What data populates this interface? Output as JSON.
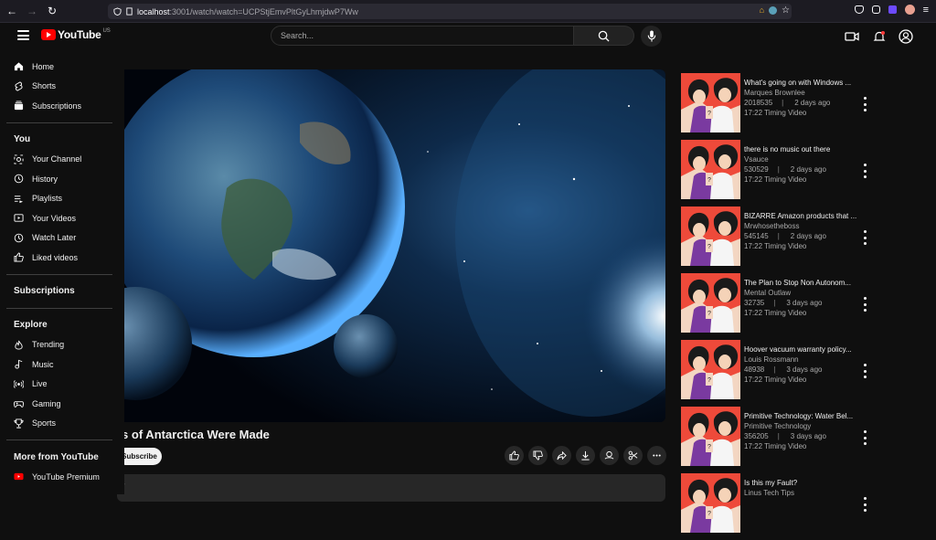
{
  "browser": {
    "url_host": "localhost",
    "url_path": ":3001/watch/watch=UCPStjEmvPltGyLhmjdwP7Ww"
  },
  "header": {
    "logo_text": "YouTube",
    "logo_region": "US",
    "search_placeholder": "Search..."
  },
  "sidebar": {
    "main": [
      {
        "label": "Home",
        "icon": "home-icon"
      },
      {
        "label": "Shorts",
        "icon": "shorts-icon"
      },
      {
        "label": "Subscriptions",
        "icon": "subscriptions-icon"
      }
    ],
    "you_heading": "You",
    "you": [
      {
        "label": "Your Channel",
        "icon": "channel-icon"
      },
      {
        "label": "History",
        "icon": "history-icon"
      },
      {
        "label": "Playlists",
        "icon": "playlists-icon"
      },
      {
        "label": "Your Videos",
        "icon": "your-videos-icon"
      },
      {
        "label": "Watch Later",
        "icon": "clock-icon"
      },
      {
        "label": "Liked videos",
        "icon": "thumbs-up-icon"
      }
    ],
    "subscriptions_heading": "Subscriptions",
    "explore_heading": "Explore",
    "explore": [
      {
        "label": "Trending",
        "icon": "fire-icon"
      },
      {
        "label": "Music",
        "icon": "music-icon"
      },
      {
        "label": "Live",
        "icon": "live-icon"
      },
      {
        "label": "Gaming",
        "icon": "gamepad-icon"
      },
      {
        "label": "Sports",
        "icon": "trophy-icon"
      }
    ],
    "more_heading": "More from YouTube",
    "more": [
      {
        "label": "YouTube Premium",
        "icon": "youtube-icon"
      }
    ]
  },
  "video": {
    "title_fragment": "rs of Antarctica Were Made",
    "subscribe_label": "Subscribe",
    "desc_fragment": "o"
  },
  "recommendations": [
    {
      "title": "What's going on with Windows ...",
      "channel": "Marques Brownlee",
      "views": "2018535",
      "ago": "2 days ago",
      "sub": "17:22 Timing Video"
    },
    {
      "title": "there is no music out there",
      "channel": "Vsauce",
      "views": "530529",
      "ago": "2 days ago",
      "sub": "17:22 Timing Video"
    },
    {
      "title": "BIZARRE Amazon products that ...",
      "channel": "Mrwhosetheboss",
      "views": "545145",
      "ago": "2 days ago",
      "sub": "17:22 Timing Video"
    },
    {
      "title": "The Plan to Stop Non Autonom...",
      "channel": "Mental Outlaw",
      "views": "32735",
      "ago": "3 days ago",
      "sub": "17:22 Timing Video"
    },
    {
      "title": "Hoover vacuum warranty policy...",
      "channel": "Louis Rossmann",
      "views": "48938",
      "ago": "3 days ago",
      "sub": "17:22 Timing Video"
    },
    {
      "title": "Primitive Technology: Water Bel...",
      "channel": "Primitive Technology",
      "views": "356205",
      "ago": "3 days ago",
      "sub": "17:22 Timing Video"
    },
    {
      "title": "Is this my Fault?",
      "channel": "Linus Tech Tips",
      "views": "",
      "ago": "",
      "sub": ""
    }
  ]
}
